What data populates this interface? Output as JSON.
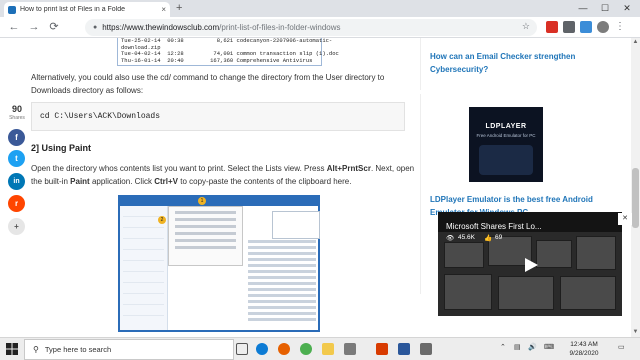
{
  "browser": {
    "tab_title": "How to print list of Files in a Folde",
    "tab_close": "×",
    "new_tab": "+",
    "url_host": "https://www.thewindowsclub.com",
    "url_path": "/print-list-of-files-in-folder-windows",
    "window_min": "—",
    "window_max": "☐",
    "window_close": "✕",
    "back": "←",
    "forward": "→",
    "reload": "⟳",
    "star": "☆"
  },
  "article": {
    "code_top_lines": [
      "Tue-25-02-14  00:38          8,621 codecanyon-2207906-automatic-",
      "download.zip",
      "Tue-04-02-14  12:28         74,001 common transaction slip (1).doc",
      "Thu-16-01-14  20:40        167,360 Comprehensive Antivirus"
    ],
    "paragraph_1": "Alternatively, you could also use the cd/ command to change the directory from the User directory to Downloads directory as follows:",
    "code_cmd": "cd C:\\Users\\ACK\\Downloads",
    "heading_2": "2] Using Paint",
    "paragraph_2a": "Open the directory whos contents list you want to print. Select the Lists view. Press",
    "paragraph_2_bold1": "Alt+PrntScr",
    "paragraph_2b": ". Next,",
    "paragraph_2c": "open the built-in",
    "paragraph_2_bold2": "Paint",
    "paragraph_2d": "application. Click",
    "paragraph_2_bold3": "Ctrl+V",
    "paragraph_2e": "to copy-paste the contents of the clipboard here.",
    "shot_badge_1": "1",
    "shot_badge_2": "2"
  },
  "share": {
    "count": "90",
    "label": "Shares",
    "buttons": [
      {
        "name": "facebook",
        "glyph": "f",
        "color": "#3b5998"
      },
      {
        "name": "twitter",
        "glyph": "t",
        "color": "#1da1f2"
      },
      {
        "name": "linkedin",
        "glyph": "in",
        "color": "#0077b5"
      },
      {
        "name": "reddit",
        "glyph": "r",
        "color": "#ff4500"
      },
      {
        "name": "more",
        "glyph": "+",
        "color": "#e6e6e6"
      }
    ]
  },
  "sidebar": {
    "link_1": "How can an Email Checker strengthen Cybersecurity?",
    "ad_logo": "LDPLAYER",
    "ad_sub": "Free Android Emulator for PC",
    "link_2": "LDPlayer Emulator is the best free Android Emulator for Windows PC"
  },
  "video": {
    "title": "Microsoft Shares First Lo...",
    "views": "45.6K",
    "likes": "69",
    "close": "✕"
  },
  "taskbar": {
    "search_placeholder": "Type here to search",
    "time": "12:43 AM",
    "date": "9/28/2020"
  },
  "colors": {
    "link": "#1f75b8",
    "taskbar": "#ededed",
    "accent": "#2b6cb8"
  }
}
